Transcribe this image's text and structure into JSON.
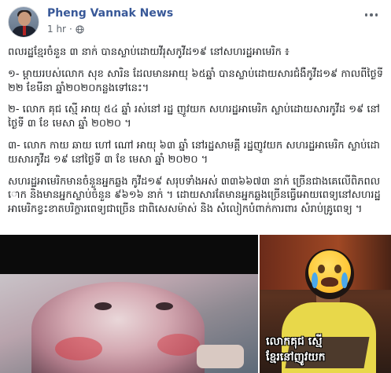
{
  "post": {
    "page_name": "Pheng Vannak News",
    "timestamp": "1 hr",
    "privacy_icon": "globe-icon",
    "more_icon": "more-horizontal-icon",
    "paragraphs": [
      "ពលរដ្ឋខ្មែរចំនួន ៣ នាក់ បានស្លាប់ដោយវីរុសកូវីដ១៩ នៅសហរដ្ឋអាមេរិក ៖",
      "១- ម្តាយរបស់លោក សុខ សារិន ដែលមានអាយុ ៦៥ឆ្នាំ បានស្លាប់ដោយសារជំងឺកូវីដ១៩ កាលពីថ្ងៃទី២២ ខែមីនា ឆ្នាំ២០២០កន្លងទៅនេះ។",
      "២- លោក គុជ ស្មើ អាយុ ៥៤ ឆ្នាំ រស់នៅ រដ្ឋ ញូវយក សហរដ្ឋអាមេរិក ស្លាប់ដោយសារកូវីដ ១៩ នៅថ្ងៃទី ៣ ខែ មេសា ឆ្នាំ ២០២០ ។",
      "៣- លោក កាយ ឆាយ ហៅ ណៅ អាយុ ៦៣ ឆ្នាំ នៅរដ្ឋសាមគ្គី រដ្ឋញូវយក សហរដ្ឋអាមេរិក ស្លាប់ដោយសារកូវីដ ១៩ នៅថ្ងៃទី ៣ ខែ មេសា ឆ្នាំ ២០២០ ។",
      "សហរដ្ឋអាមេរិកមានចំនួនអ្នកឆ្លង កូវីដ១៩ សរុបទាំងអស់ ៣៣៦៦៧៣ នាក់ ច្រើនជាងគេលើពិភពលោក និងមានអ្នកស្លាប់ចំនួន ៩៦១៦ នាក់ ។ ដោយសារតែមានអ្នកឆ្លងច្រើនធ្វើអោយពេទ្យនៅសហរដ្ឋអាមេរិកខ្វះខាតបរិក្ខារពេទ្យជាច្រើន ជាពិសេសម៉ាស់ និង សំលៀកបំពាក់ការពារ សំរាប់គ្រូពេទ្យ ។"
    ]
  },
  "media": {
    "right_caption_line1": "លោកគុជ ស្មើ",
    "right_caption_line2": "ខ្មែរនៅញូវយក",
    "emoji_icon": "crying-face-icon"
  },
  "colors": {
    "page_name": "#385898",
    "meta": "#606770",
    "text": "#1c1e21"
  }
}
